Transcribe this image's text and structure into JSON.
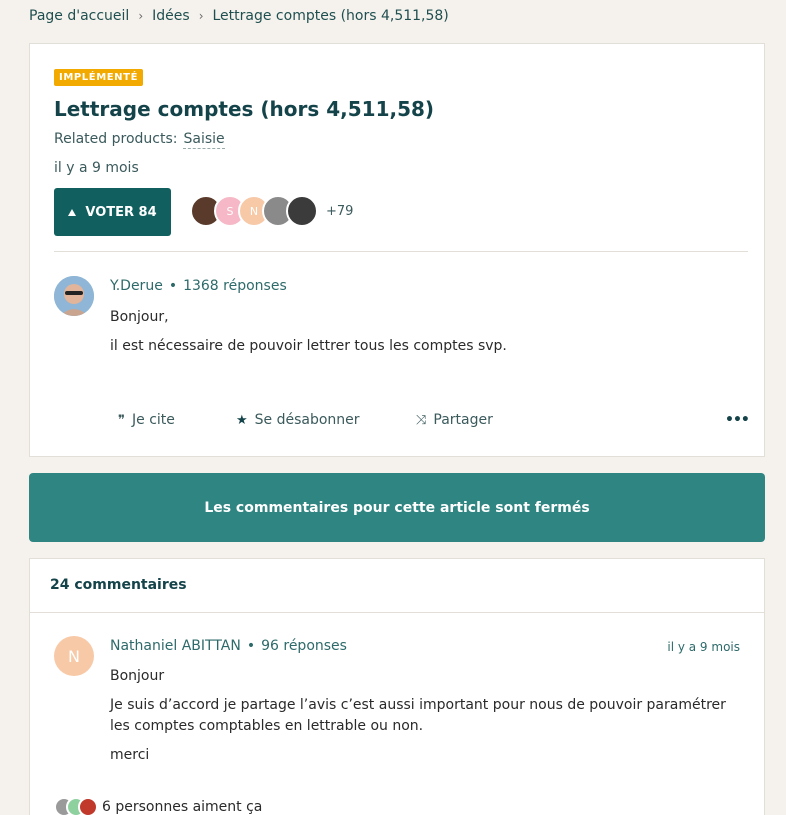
{
  "breadcrumb": {
    "home": "Page d'accueil",
    "section": "Idées",
    "current": "Lettrage comptes (hors 4,511,58)"
  },
  "article": {
    "status_badge": "IMPLÉMENTÉ",
    "title": "Lettrage comptes (hors 4,511,58)",
    "related_label": "Related products:",
    "related_product": "Saisie",
    "posted": "il y a 9 mois",
    "vote_label": "VOTER 84",
    "voters_more": "+79",
    "voter_initials": [
      "",
      "S",
      "N",
      "",
      ""
    ],
    "author": "Y.Derue",
    "author_replies": "1368 réponses",
    "body": [
      "Bonjour,",
      "il est nécessaire de pouvoir lettrer tous les comptes svp."
    ],
    "actions": {
      "quote": "Je cite",
      "unsubscribe": "Se désabonner",
      "share": "Partager"
    }
  },
  "closed_notice": "Les commentaires pour cette article sont fermés",
  "comments": {
    "count_label": "24 commentaires",
    "first": {
      "initial": "N",
      "author": "Nathaniel ABITTAN",
      "replies": "96 réponses",
      "time": "il y a 9 mois",
      "body": [
        "Bonjour",
        "Je suis d’accord je partage l’avis c’est aussi important pour nous de pouvoir paramétrer les comptes comptables en lettrable ou non.",
        "merci"
      ],
      "likes": "6 personnes aiment ça"
    }
  },
  "colors": {
    "accent": "#11605f",
    "banner": "#2f8582",
    "badge": "#f2a900"
  }
}
